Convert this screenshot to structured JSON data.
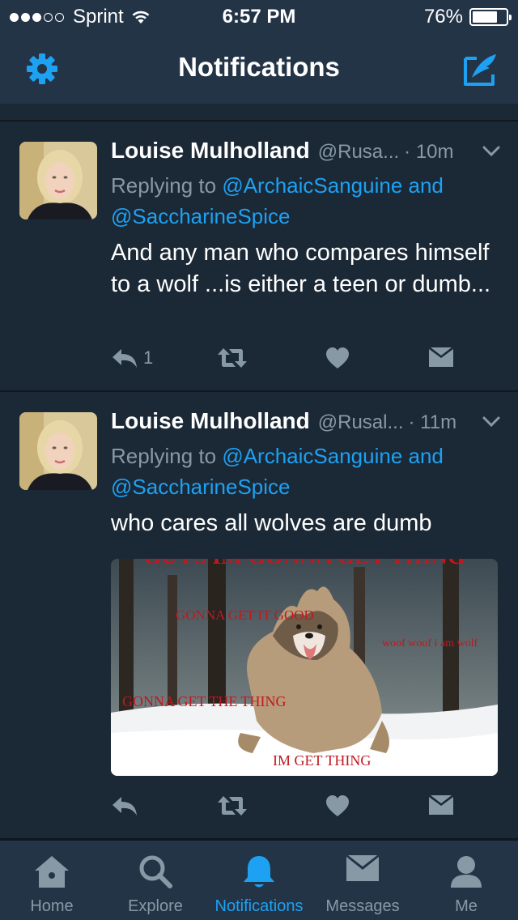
{
  "status_bar": {
    "carrier": "Sprint",
    "time": "6:57 PM",
    "battery": "76%",
    "battery_level": 0.76,
    "signal_bars_filled": 3,
    "signal_bars_total": 5
  },
  "header": {
    "title": "Notifications",
    "settings_icon": "gear-icon",
    "compose_icon": "compose-icon"
  },
  "tweets": [
    {
      "name": "Louise Mulholland",
      "handle": "@Rusa...",
      "time": "· 10m",
      "reply_prefix": "Replying to",
      "reply_mention_1": "@ArchaicSanguine",
      "reply_and": "and",
      "reply_mention_2": "@SaccharineSpice",
      "text": "And any man who compares himself to a wolf ...is either a teen or dumb...",
      "reply_count": "1"
    },
    {
      "name": "Louise Mulholland",
      "handle": "@Rusal...",
      "time": "· 11m",
      "reply_prefix": "Replying to",
      "reply_mention_1": "@ArchaicSanguine",
      "reply_and": "and",
      "reply_mention_2": "@SaccharineSpice",
      "text": "who cares all wolves are dumb",
      "reply_count": "",
      "media": {
        "top_caption": "GUYS IM GONNA GET THING",
        "caption_1": "GONNA GET IT GOOD",
        "caption_2": "woof woof i am wolf",
        "caption_3": "GONNA GET THE THING",
        "caption_4": "IM GET THING"
      }
    }
  ],
  "tab_bar": [
    {
      "label": "Home",
      "icon": "home-icon",
      "active": false
    },
    {
      "label": "Explore",
      "icon": "search-icon",
      "active": false
    },
    {
      "label": "Notifications",
      "icon": "bell-icon",
      "active": true
    },
    {
      "label": "Messages",
      "icon": "envelope-icon",
      "active": false
    },
    {
      "label": "Me",
      "icon": "person-icon",
      "active": false
    }
  ],
  "colors": {
    "background": "#1b2836",
    "bar": "#243447",
    "accent": "#1da1f2",
    "muted": "#8899a6"
  }
}
